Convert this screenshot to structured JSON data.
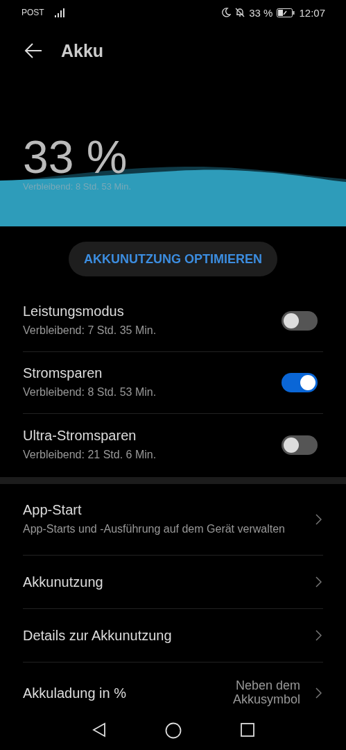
{
  "status_bar": {
    "carrier": "POST",
    "battery": "33 %",
    "time": "12:07"
  },
  "header": {
    "title": "Akku"
  },
  "battery": {
    "percent": "33 %",
    "remaining": "Verbleibend: 8 Std. 53 Min."
  },
  "optimize_button": "AKKUNUTZUNG OPTIMIEREN",
  "modes": [
    {
      "title": "Leistungsmodus",
      "subtitle": "Verbleibend: 7 Std. 35 Min.",
      "on": false
    },
    {
      "title": "Stromsparen",
      "subtitle": "Verbleibend: 8 Std. 53 Min.",
      "on": true
    },
    {
      "title": "Ultra-Stromsparen",
      "subtitle": "Verbleibend: 21 Std. 6 Min.",
      "on": false
    }
  ],
  "settings": [
    {
      "title": "App-Start",
      "subtitle": "App-Starts und -Ausführung auf dem Gerät verwalten"
    },
    {
      "title": "Akkunutzung"
    },
    {
      "title": "Details zur Akkunutzung"
    },
    {
      "title": "Akkuladung in %",
      "value": "Neben dem Akkusymbol"
    }
  ]
}
